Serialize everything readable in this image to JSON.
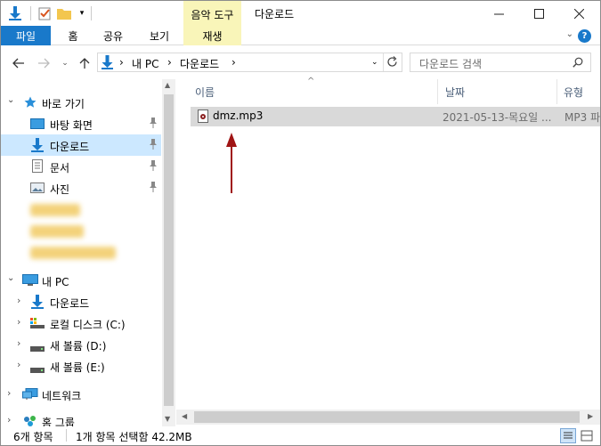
{
  "window": {
    "title": "다운로드",
    "context_tab_group": "음악 도구"
  },
  "ribbon": {
    "tabs": [
      "파일",
      "홈",
      "공유",
      "보기",
      "재생"
    ]
  },
  "address": {
    "crumbs": [
      "내 PC",
      "다운로드"
    ],
    "search_placeholder": "다운로드 검색"
  },
  "nav": {
    "quick_access": "바로 가기",
    "quick_items": [
      "바탕 화면",
      "다운로드",
      "문서",
      "사진"
    ],
    "this_pc": "내 PC",
    "pc_items": [
      "다운로드",
      "로컬 디스크 (C:)",
      "새 볼륨 (D:)",
      "새 볼륨 (E:)"
    ],
    "network": "네트워크",
    "homegroup": "홈 그룹"
  },
  "columns": [
    "이름",
    "날짜",
    "유형"
  ],
  "files": [
    {
      "name": "dmz.mp3",
      "date": "2021-05-13-목요일 ...",
      "type": "MP3 파"
    }
  ],
  "status": {
    "count": "6개 항목",
    "selection": "1개 항목 선택함 42.2MB"
  },
  "colors": {
    "accent": "#1979ca",
    "context_tab": "#f9f5b9",
    "selection": "#cce8ff",
    "file_row": "#d9d9d9",
    "arrow": "#a01414"
  }
}
